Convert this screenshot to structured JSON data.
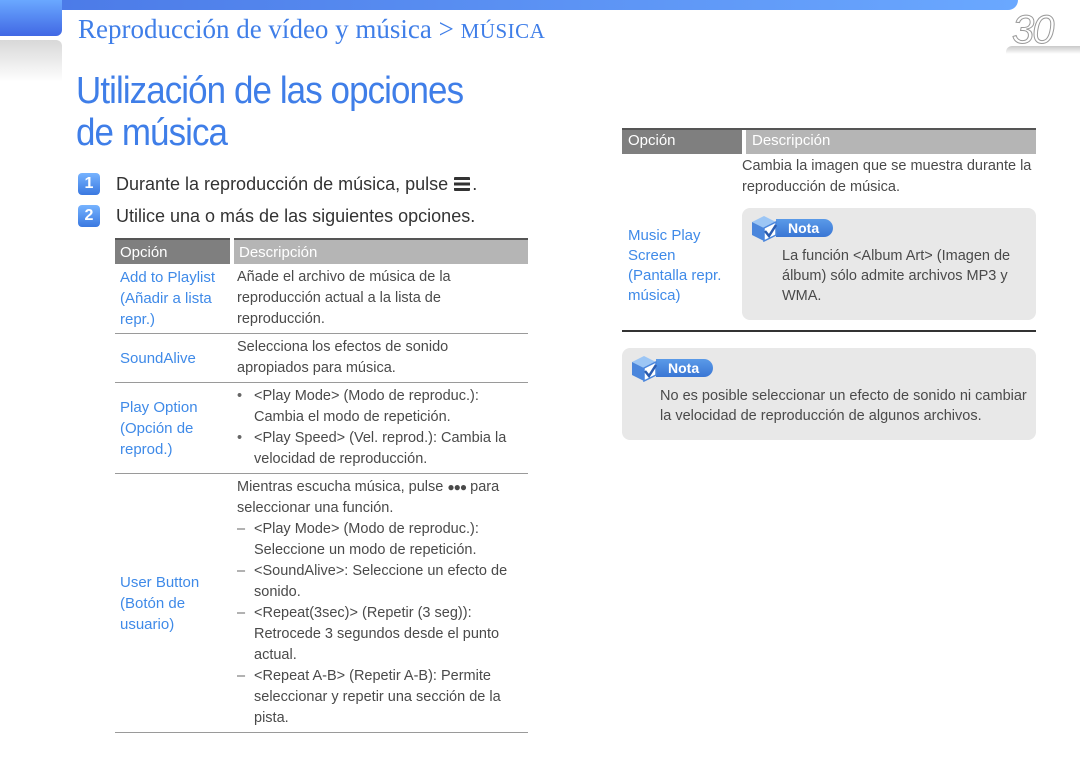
{
  "header": {
    "breadcrumb_section": "Reproducción de vídeo y música > ",
    "breadcrumb_current": "MÚSICA",
    "page_number": "30",
    "accent_color": "#3f7ee8"
  },
  "page_title": "Utilización de las opciones de música",
  "steps": [
    {
      "number": "1",
      "text": "Durante la reproducción de música, pulse",
      "icon": "menu-icon",
      "suffix": "."
    },
    {
      "number": "2",
      "text": "Utilice una o más de las siguientes opciones."
    }
  ],
  "table_left": {
    "headers": [
      "Opción",
      "Descripción"
    ],
    "rows": [
      {
        "option": "Add to Playlist (Añadir a lista repr.)",
        "description": "Añade el archivo de música de la reproducción actual a la lista de reproducción."
      },
      {
        "option": "SoundAlive",
        "description": "Selecciona los efectos de sonido apropiados para música."
      },
      {
        "option": "Play Option (Opción de reprod.)",
        "bullets": [
          "<Play Mode> (Modo de reproduc.): Cambia el modo de repetición.",
          "<Play Speed> (Vel. reprod.): Cambia la velocidad de reproducción."
        ]
      },
      {
        "option": "User Button (Botón de usuario)",
        "intro_before_icon": "Mientras escucha música, pulse",
        "intro_icon": "more-dots-icon",
        "intro_after_icon": "para seleccionar una función.",
        "dashes": [
          "<Play Mode> (Modo de reproduc.): Seleccione un modo de repetición.",
          "<SoundAlive>: Seleccione un efecto de sonido.",
          "<Repeat(3sec)> (Repetir (3 seg)): Retrocede 3 segundos desde el punto actual.",
          "<Repeat A-B> (Repetir A-B): Permite seleccionar y repetir una sección de la pista."
        ]
      }
    ]
  },
  "table_right": {
    "headers": [
      "Opción",
      "Descripción"
    ],
    "row": {
      "option": "Music Play Screen (Pantalla repr. música)",
      "description": "Cambia la imagen que se muestra durante la reproducción de música.",
      "note_label": "Nota",
      "note_text": "La función <Album Art> (Imagen de álbum) sólo admite archivos MP3 y WMA."
    }
  },
  "bottom_note": {
    "label": "Nota",
    "text": "No es posible seleccionar un efecto de sonido ni cambiar la velocidad de reproducción de algunos archivos."
  }
}
